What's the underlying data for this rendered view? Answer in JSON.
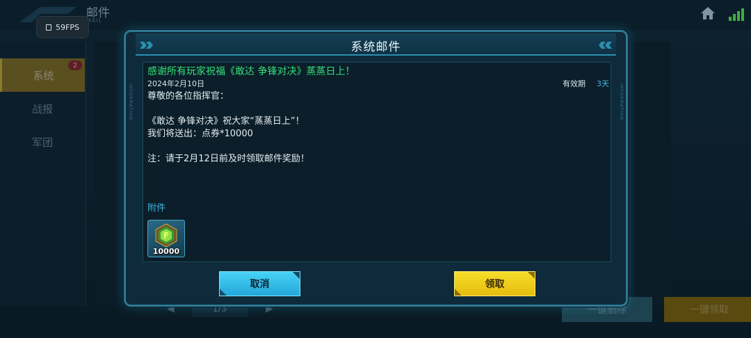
{
  "hud": {
    "fps_text": "59FPS",
    "page_title": "邮件",
    "page_subtitle": "MAIL"
  },
  "sidebar": {
    "tabs": [
      {
        "label": "系统",
        "badge": "2",
        "active": true
      },
      {
        "label": "战报"
      },
      {
        "label": "军团"
      }
    ]
  },
  "pager": {
    "text": "1/3"
  },
  "background_buttons": {
    "refresh_label": "一键删除",
    "claim_all_label": "一键领取"
  },
  "modal": {
    "title": "系统邮件",
    "side_text": "INFORMATION",
    "subject": "感谢所有玩家祝福《敢达 争锋对决》蒸蒸日上！",
    "date": "2024年2月10日",
    "expiry_label": "有效期",
    "expiry_value": "3天",
    "body_lines": [
      "尊敬的各位指挥官：",
      "",
      "《敢达 争锋对决》祝大家“蒸蒸日上”！",
      "我们将送出：点券*10000",
      "",
      "注：请于2月12日前及时领取邮件奖励！"
    ],
    "attachment_label": "附件",
    "attachment": {
      "icon": "point-coupon-icon",
      "quantity": "10000"
    },
    "cancel_label": "取消",
    "claim_label": "领取"
  },
  "colors": {
    "subject": "#35e07a",
    "accent": "#3fb5e6",
    "cancel_button": "#2fbbe6",
    "claim_button": "#f0cc18"
  }
}
